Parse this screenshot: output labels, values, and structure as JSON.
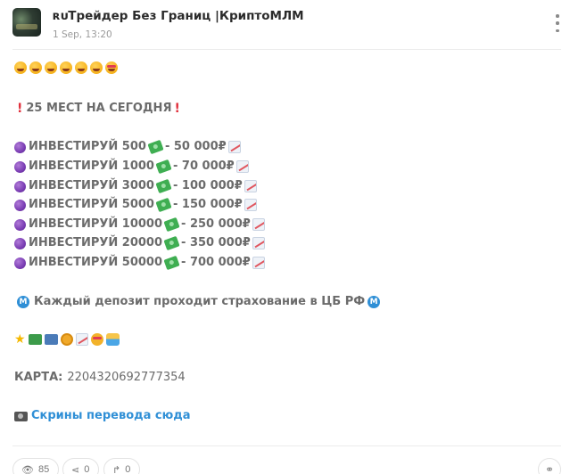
{
  "post": {
    "channel_name": "ʀᴜТрейдер Без Границ |КриптоМЛМ",
    "date": "1 Sep, 13:20"
  },
  "content": {
    "top_emojis": [
      "grinning-face-icon",
      "smiling-face-icon",
      "grimacing-face-icon",
      "pleading-face-icon",
      "laughing-face-icon",
      "yum-face-icon",
      "heart-eyes-face-icon"
    ],
    "headline": "25 МЕСТ НА СЕГОДНЯ",
    "invest_rows": [
      {
        "label": "ИНВЕСТИРУЙ 500",
        "result": "- 50 000₽"
      },
      {
        "label": "ИНВЕСТИРУЙ 1000",
        "result": "- 70 000₽"
      },
      {
        "label": "ИНВЕСТИРУЙ 3000",
        "result": "- 100 000₽"
      },
      {
        "label": "ИНВЕСТИРУЙ 5000",
        "result": "- 150 000₽"
      },
      {
        "label": "ИНВЕСТИРУЙ 10000",
        "result": "- 250 000₽"
      },
      {
        "label": "ИНВЕСТИРУЙ 20000",
        "result": "- 350 000₽"
      },
      {
        "label": "ИНВЕСТИРУЙ 50000",
        "result": "- 700 000₽"
      }
    ],
    "insurance_text": "Каждый депозит проходит страхование в ЦБ РФ",
    "card_label": "КАРТА:",
    "card_number": "2204320692777354",
    "screenshots_link": "Скрины перевода сюда"
  },
  "footer": {
    "views": "85",
    "shares": "0",
    "forwards": "0"
  },
  "colors": {
    "link": "#2f8fd6",
    "text": "#6b6b6b",
    "exclamation": "#e0303c"
  }
}
